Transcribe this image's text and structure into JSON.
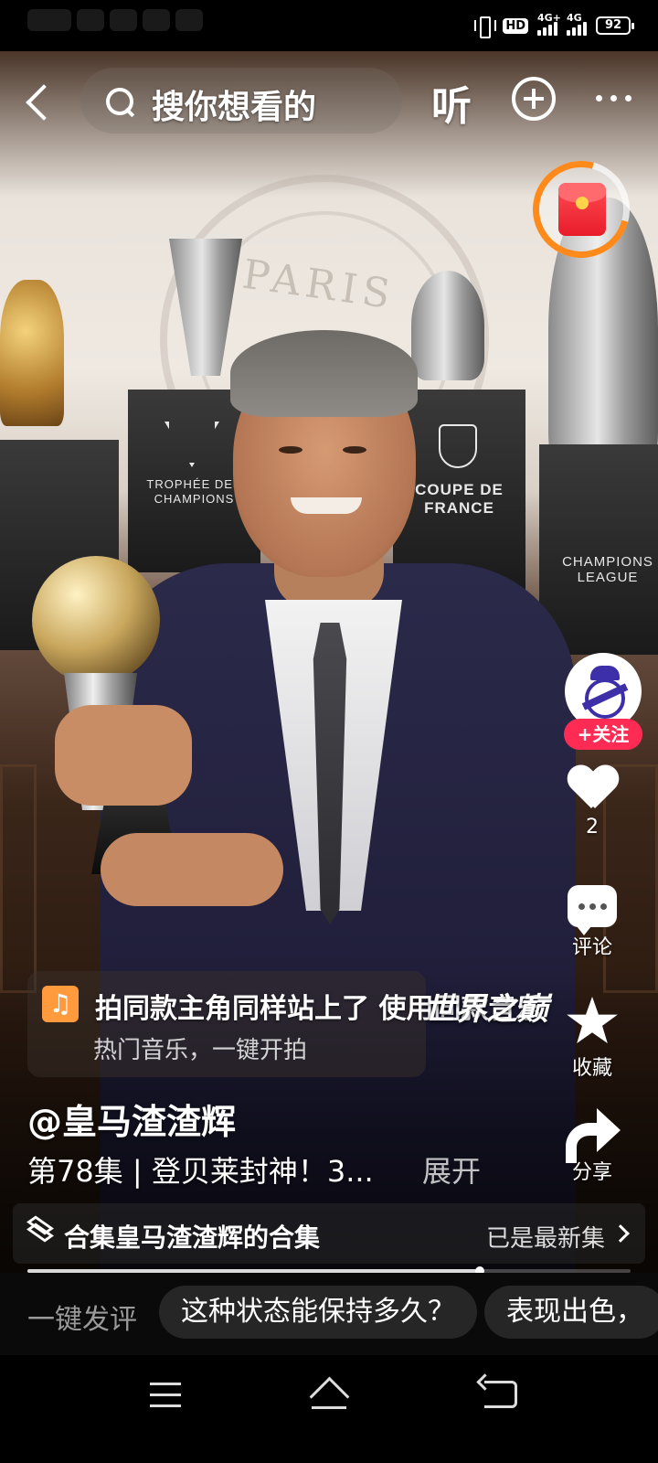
{
  "status_bar": {
    "hd_label": "HD",
    "sim1_label": "4G+",
    "sim2_label": "4G",
    "battery": "92"
  },
  "top_bar": {
    "search_placeholder": "搜你想看的",
    "listen_label": "听"
  },
  "video": {
    "background_text": "PARIS",
    "pedestal_labels": [
      "TROPHÉE DES CHAMPIONS",
      "COUPE DE FRANCE",
      "CHAMPIONS LEAGUE"
    ],
    "caption_text": "世界之巅"
  },
  "music_banner": {
    "line1": "拍同款主角同样站上了 使用同款音乐",
    "line2": "热门音乐，一键开拍"
  },
  "rail": {
    "follow_label": "+关注",
    "like_count": "2",
    "comment_label": "评论",
    "favorite_label": "收藏",
    "share_label": "分享"
  },
  "post": {
    "author": "@皇马渣渣辉",
    "description": "第78集 | 登贝莱封神！3...",
    "expand_label": "展开"
  },
  "collection": {
    "title": "合集皇马渣渣辉的合集",
    "status": "已是最新集"
  },
  "playback": {
    "progress_fraction": 0.75
  },
  "quick_comment": {
    "label": "一键发评",
    "chips": [
      "这种状态能保持多久？",
      "表现出色，"
    ]
  },
  "colors": {
    "accent_red": "#fe2c55",
    "redpacket_ring": "#ff8a1c",
    "music_orange": "#ff9a3d"
  }
}
